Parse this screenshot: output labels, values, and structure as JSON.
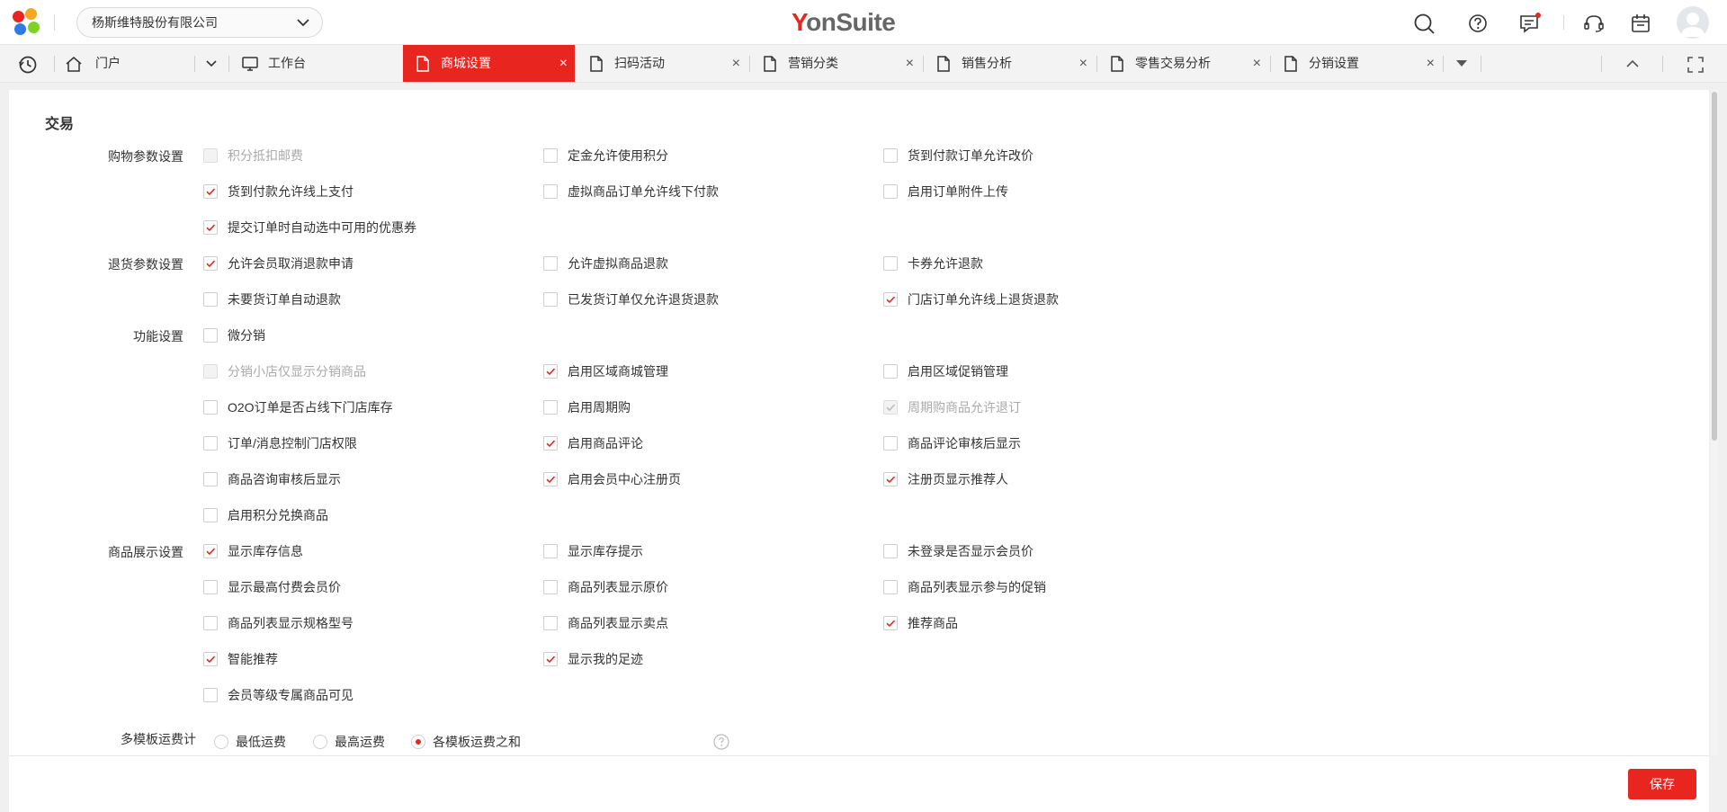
{
  "header": {
    "org_name": "杨斯维特股份有限公司",
    "brand_prefix": "Y",
    "brand_rest": "onSuite",
    "colors": {
      "accent": "#e8251f",
      "logo": [
        "#e8251f",
        "#f5a623",
        "#2f7be5",
        "#7ed321"
      ]
    },
    "icons": [
      "search-icon",
      "help-icon",
      "message-icon",
      "headset-icon",
      "calendar-icon",
      "avatar"
    ]
  },
  "tabs": {
    "home": "门户",
    "items": [
      {
        "label": "工作台",
        "icon": "monitor-icon"
      },
      {
        "label": "商城设置",
        "icon": "document-icon",
        "active": true
      },
      {
        "label": "扫码活动",
        "icon": "document-icon"
      },
      {
        "label": "营销分类",
        "icon": "document-icon"
      },
      {
        "label": "销售分析",
        "icon": "document-icon"
      },
      {
        "label": "零售交易分析",
        "icon": "document-icon"
      },
      {
        "label": "分销设置",
        "icon": "document-icon"
      }
    ],
    "close_glyph": "×"
  },
  "section": {
    "title": "交易"
  },
  "groups": {
    "shopping": "购物参数设置",
    "returns": "退货参数设置",
    "features": "功能设置",
    "display": "商品展示设置",
    "shipping": "多模板运费计"
  },
  "options": {
    "o1": {
      "label": "积分抵扣邮费",
      "checked": false,
      "disabled": true
    },
    "o2": {
      "label": "定金允许使用积分",
      "checked": false
    },
    "o3": {
      "label": "货到付款订单允许改价",
      "checked": false
    },
    "o4": {
      "label": "货到付款允许线上支付",
      "checked": true
    },
    "o5": {
      "label": "虚拟商品订单允许线下付款",
      "checked": false
    },
    "o6": {
      "label": "启用订单附件上传",
      "checked": false
    },
    "o7": {
      "label": "提交订单时自动选中可用的优惠券",
      "checked": true
    },
    "o8": {
      "label": "允许会员取消退款申请",
      "checked": true
    },
    "o9": {
      "label": "允许虚拟商品退款",
      "checked": false
    },
    "o10": {
      "label": "卡券允许退款",
      "checked": false
    },
    "o11": {
      "label": "未要货订单自动退款",
      "checked": false
    },
    "o12": {
      "label": "已发货订单仅允许退货退款",
      "checked": false
    },
    "o13": {
      "label": "门店订单允许线上退货退款",
      "checked": true
    },
    "o14": {
      "label": "微分销",
      "checked": false
    },
    "o15": {
      "label": "分销小店仅显示分销商品",
      "checked": false,
      "disabled": true
    },
    "o16": {
      "label": "启用区域商城管理",
      "checked": true
    },
    "o17": {
      "label": "启用区域促销管理",
      "checked": false
    },
    "o18": {
      "label": "O2O订单是否占线下门店库存",
      "checked": false
    },
    "o19": {
      "label": "启用周期购",
      "checked": false
    },
    "o20": {
      "label": "周期购商品允许退订",
      "checked": true,
      "disabled": true
    },
    "o21": {
      "label": "订单/消息控制门店权限",
      "checked": false
    },
    "o22": {
      "label": "启用商品评论",
      "checked": true
    },
    "o23": {
      "label": "商品评论审核后显示",
      "checked": false
    },
    "o24": {
      "label": "商品咨询审核后显示",
      "checked": false
    },
    "o25": {
      "label": "启用会员中心注册页",
      "checked": true
    },
    "o26": {
      "label": "注册页显示推荐人",
      "checked": true
    },
    "o27": {
      "label": "启用积分兑换商品",
      "checked": false
    },
    "o28": {
      "label": "显示库存信息",
      "checked": true
    },
    "o29": {
      "label": "显示库存提示",
      "checked": false
    },
    "o30": {
      "label": "未登录是否显示会员价",
      "checked": false
    },
    "o31": {
      "label": "显示最高付费会员价",
      "checked": false
    },
    "o32": {
      "label": "商品列表显示原价",
      "checked": false
    },
    "o33": {
      "label": "商品列表显示参与的促销",
      "checked": false
    },
    "o34": {
      "label": "商品列表显示规格型号",
      "checked": false
    },
    "o35": {
      "label": "商品列表显示卖点",
      "checked": false
    },
    "o36": {
      "label": "推荐商品",
      "checked": true
    },
    "o37": {
      "label": "智能推荐",
      "checked": true
    },
    "o38": {
      "label": "显示我的足迹",
      "checked": true
    },
    "o39": {
      "label": "会员等级专属商品可见",
      "checked": false
    }
  },
  "shipping": {
    "r1": {
      "label": "最低运费",
      "selected": false
    },
    "r2": {
      "label": "最高运费",
      "selected": false
    },
    "r3": {
      "label": "各模板运费之和",
      "selected": true
    }
  },
  "footer": {
    "save_label": "保存"
  }
}
